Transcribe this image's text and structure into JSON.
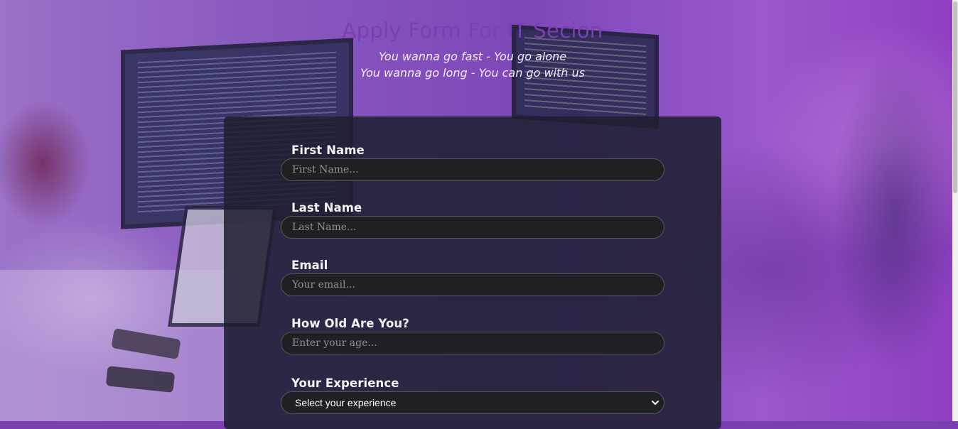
{
  "header": {
    "title": "Apply Form For IT Secion",
    "subtitle_line1": "You wanna go fast - You go alone",
    "subtitle_line2": "You wanna go long - You can go with us"
  },
  "form": {
    "first_name": {
      "label": "First Name",
      "placeholder": "First Name..."
    },
    "last_name": {
      "label": "Last Name",
      "placeholder": "Last Name..."
    },
    "email": {
      "label": "Email",
      "placeholder": "Your email..."
    },
    "age": {
      "label": "How Old Are You?",
      "placeholder": "Enter your age..."
    },
    "experience": {
      "label": "Your Experience",
      "selected": "Select your experience"
    }
  },
  "colors": {
    "title": "#7b3fb2",
    "panel": "#1e1e30",
    "input_bg": "#1f2024",
    "overlay": "#8a4fc0"
  },
  "icons": [
    "chevron-down-icon"
  ]
}
